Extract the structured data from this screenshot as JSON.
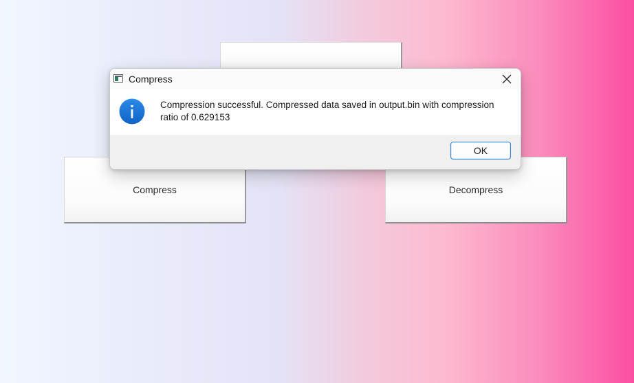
{
  "background_buttons": {
    "top_label": "",
    "compress_label": "Compress",
    "decompress_label": "Decompress"
  },
  "dialog": {
    "title": "Compress",
    "message": "Compression successful. Compressed data saved in output.bin with compression ratio of 0.629153",
    "ok_label": "OK",
    "icon": "info-icon",
    "close_icon": "close-icon"
  },
  "colors": {
    "gradient_start": "#f1f6ff",
    "gradient_end": "#fb4ea3",
    "info_blue": "#1a73d2",
    "ok_border": "#3b86d4"
  }
}
